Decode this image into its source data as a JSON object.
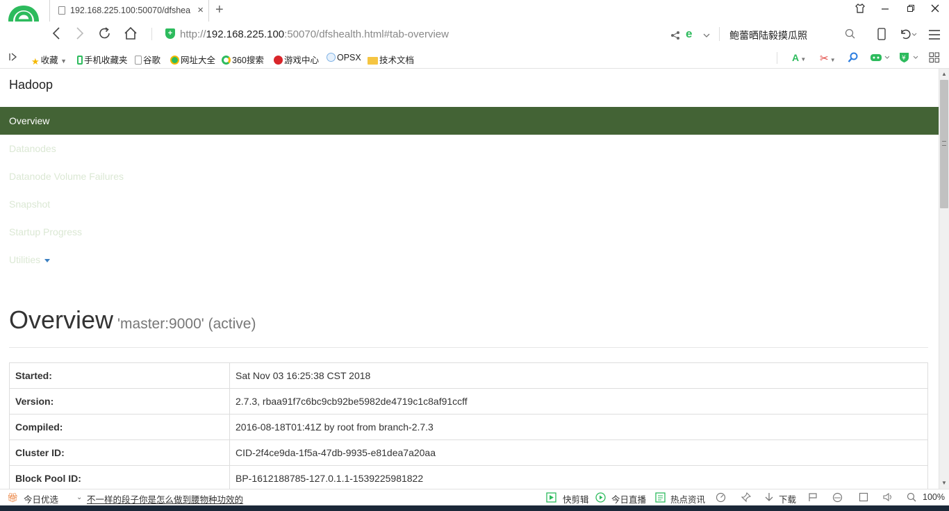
{
  "browser": {
    "tab_title": "192.168.225.100:50070/dfshea",
    "tab_close": "×",
    "new_tab": "+",
    "url_scheme": "http://",
    "url_host": "192.168.225.100",
    "url_rest": ":50070/dfshealth.html#tab-overview",
    "search_box": "鲍蕾晒陆毅摸瓜照",
    "zoom": "100%"
  },
  "bookmarks": [
    {
      "label": "收藏",
      "color": "#f5b800"
    },
    {
      "label": "手机收藏夹",
      "color": "#2dbb5d"
    },
    {
      "label": "谷歌",
      "color": "#999999"
    },
    {
      "label": "网址大全",
      "color": "#2dbb5d"
    },
    {
      "label": "360搜索",
      "color": "#f5b800"
    },
    {
      "label": "游戏中心",
      "color": "#d9252a"
    },
    {
      "label": "OPSX",
      "color": "#7fb2e5"
    },
    {
      "label": "技术文档",
      "color": "#f5c542"
    }
  ],
  "hadoop": {
    "brand": "Hadoop",
    "nav": {
      "overview": "Overview",
      "datanodes": "Datanodes",
      "volume_failures": "Datanode Volume Failures",
      "snapshot": "Snapshot",
      "startup": "Startup Progress",
      "utilities": "Utilities"
    },
    "title": "Overview",
    "subtitle": "'master:9000' (active)",
    "rows": [
      {
        "key": "Started:",
        "value": "Sat Nov 03 16:25:38 CST 2018"
      },
      {
        "key": "Version:",
        "value": "2.7.3, rbaa91f7c6bc9cb92be5982de4719c1c8af91ccff"
      },
      {
        "key": "Compiled:",
        "value": "2016-08-18T01:41Z by root from branch-2.7.3"
      },
      {
        "key": "Cluster ID:",
        "value": "CID-2f4ce9da-1f5a-47db-9935-e81dea7a20aa"
      },
      {
        "key": "Block Pool ID:",
        "value": "BP-1612188785-127.0.1.1-1539225981822"
      }
    ]
  },
  "statusbar": {
    "today_picks": "今日优选",
    "headline": "不一样的段子你是怎么做到腰物种功效的",
    "quick_cut": "快剪辑",
    "live": "今日直播",
    "hot_news": "热点资讯",
    "download": "下载"
  },
  "colors": {
    "nav_active": "#436335",
    "nav_link": "#dbe8d4",
    "accent_green": "#2dbb5d"
  }
}
